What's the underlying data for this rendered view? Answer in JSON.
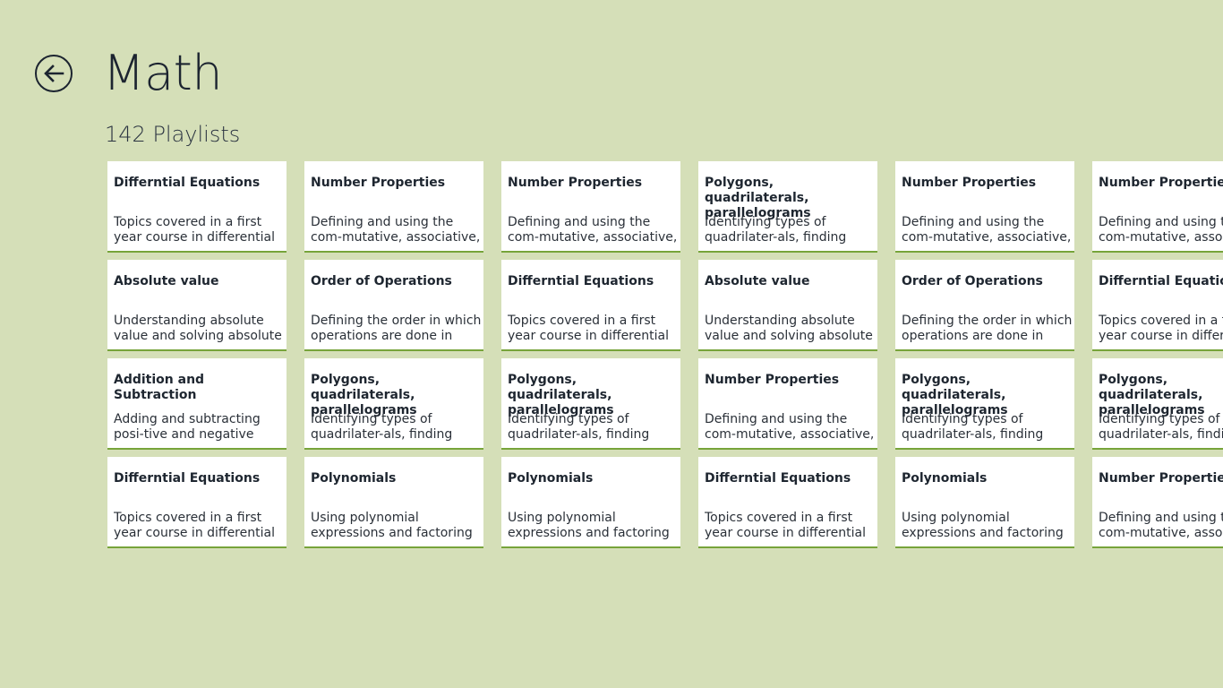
{
  "header": {
    "title": "Math",
    "subtitle": "142 Playlists",
    "back_icon": "back-arrow-icon"
  },
  "colors": {
    "background": "#d5dfb8",
    "tile_background": "#ffffff",
    "tile_accent": "#77a43a",
    "text": "#1c2430"
  },
  "rows": [
    [
      {
        "title": "Differntial Equations",
        "description": "Topics covered in a first year course in differential equations."
      },
      {
        "title": "Number Properties",
        "description": "Defining and using the com-mutative, associative, distribu-"
      },
      {
        "title": "Number Properties",
        "description": "Defining and using the com-mutative, associative, distribu-"
      },
      {
        "title": "Polygons, quadrilaterals, parallelograms",
        "description": "Identifying types of quadrilater-als, finding measurements, and"
      },
      {
        "title": "Number Properties",
        "description": "Defining and using the com-mutative, associative, distribu-"
      },
      {
        "title": "Number Properties",
        "description": "Defining and using the com-mutative, associative, distribu-"
      }
    ],
    [
      {
        "title": "Absolute value",
        "description": "Understanding absolute value and solving absolute value…"
      },
      {
        "title": "Order of Operations",
        "description": "Defining the order in which operations are done in expres-"
      },
      {
        "title": "Differntial Equations",
        "description": "Topics covered in a first year course in differential equations."
      },
      {
        "title": "Absolute value",
        "description": "Understanding absolute value and solving absolute value…"
      },
      {
        "title": "Order of Operations",
        "description": "Defining the order in which operations are done in expres-"
      },
      {
        "title": "Differntial Equations",
        "description": "Topics covered in a first year course in differential equations."
      }
    ],
    [
      {
        "title": "Addition and Subtraction",
        "description": "Adding and subtracting posi-tive and negative whole …"
      },
      {
        "title": "Polygons, quadrilaterals, parallelograms",
        "description": "Identifying types of quadrilater-als, finding measurements, and"
      },
      {
        "title": "Polygons, quadrilaterals, parallelograms",
        "description": "Identifying types of quadrilater-als, finding measurements, and"
      },
      {
        "title": "Number Properties",
        "description": "Defining and using the com-mutative, associative, distribu-"
      },
      {
        "title": "Polygons, quadrilaterals, parallelograms",
        "description": "Identifying types of quadrilater-als, finding measurements, and"
      },
      {
        "title": "Polygons, quadrilaterals, parallelograms",
        "description": "Identifying types of quadrilater-als, finding measurements, and"
      }
    ],
    [
      {
        "title": "Differntial Equations",
        "description": "Topics covered in a first year course in differential equations."
      },
      {
        "title": "Polynomials",
        "description": "Using polynomial expressions and factoring polynomials."
      },
      {
        "title": "Polynomials",
        "description": "Using polynomial expressions and factoring polynomials."
      },
      {
        "title": "Differntial Equations",
        "description": "Topics covered in a first year course in differential equations."
      },
      {
        "title": "Polynomials",
        "description": "Using polynomial expressions and factoring polynomials."
      },
      {
        "title": "Number Properties",
        "description": "Defining and using the com-mutative, associative, distribu-"
      }
    ]
  ]
}
